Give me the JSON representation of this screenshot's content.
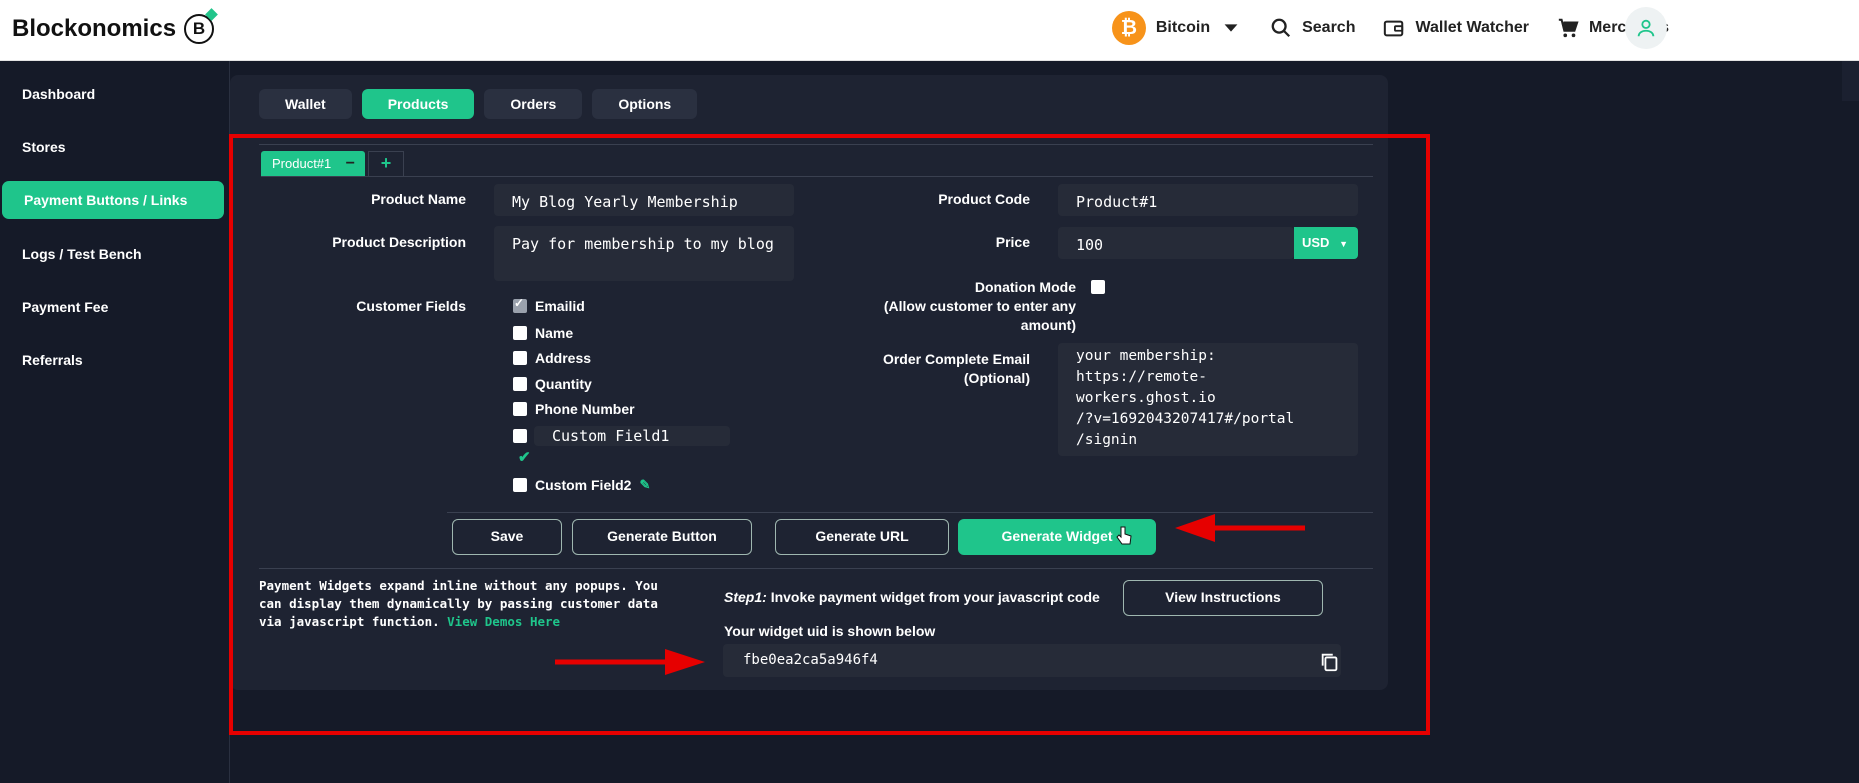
{
  "brand": {
    "name": "Blockonomics",
    "logo_letter": "B"
  },
  "nav": {
    "currency": "Bitcoin",
    "currency_symbol": "₿",
    "search": "Search",
    "wallet_watcher": "Wallet Watcher",
    "merchants": "Merchants"
  },
  "sidebar": {
    "items": [
      {
        "label": "Dashboard"
      },
      {
        "label": "Stores"
      },
      {
        "label": "Payment Buttons / Links"
      },
      {
        "label": "Logs / Test Bench"
      },
      {
        "label": "Payment Fee"
      },
      {
        "label": "Referrals"
      }
    ]
  },
  "tabs": [
    {
      "label": "Wallet"
    },
    {
      "label": "Products"
    },
    {
      "label": "Orders"
    },
    {
      "label": "Options"
    }
  ],
  "product_tab": {
    "label": "Product#1",
    "remove": "−",
    "add": "+"
  },
  "form": {
    "product_name_label": "Product Name",
    "product_name_value": "My Blog Yearly Membership",
    "product_description_label": "Product Description",
    "product_description_value": "Pay for membership to my blog",
    "customer_fields_label": "Customer Fields",
    "customer_fields": [
      {
        "label": "Emailid",
        "checked": true
      },
      {
        "label": "Name",
        "checked": false
      },
      {
        "label": "Address",
        "checked": false
      },
      {
        "label": "Quantity",
        "checked": false
      },
      {
        "label": "Phone Number",
        "checked": false
      }
    ],
    "custom_field1_value": "Custom Field1",
    "custom_field2_label": "Custom Field2",
    "product_code_label": "Product Code",
    "product_code_value": "Product#1",
    "price_label": "Price",
    "price_value": "100",
    "currency_select": "USD",
    "donation_label_line1": "Donation Mode",
    "donation_label_line2": "(Allow customer to enter any",
    "donation_label_line3": "amount)",
    "order_email_label_line1": "Order Complete Email",
    "order_email_label_line2": "(Optional)",
    "order_email_lines": [
      "your membership:",
      "https://remote-",
      "workers.ghost.io",
      "/?v=1692043207417#/portal",
      "/signin"
    ]
  },
  "buttons": {
    "save": "Save",
    "generate_button": "Generate Button",
    "generate_url": "Generate URL",
    "generate_widget": "Generate Widget"
  },
  "widget": {
    "description_line1": "Payment Widgets expand inline without any popups. You",
    "description_line2": "can display them dynamically by passing customer data",
    "description_line3": "via javascript function.",
    "view_demos": "View Demos Here",
    "step_label": "Step1:",
    "step_text": "Invoke payment widget from your javascript code",
    "view_instructions": "View Instructions",
    "uid_label": "Your widget uid is shown below",
    "uid_value": "fbe0ea2ca5a946f4"
  },
  "colors": {
    "accent": "#1fc58b",
    "annotation": "#e60000",
    "background": "#151a28",
    "panel": "#1e2332"
  }
}
